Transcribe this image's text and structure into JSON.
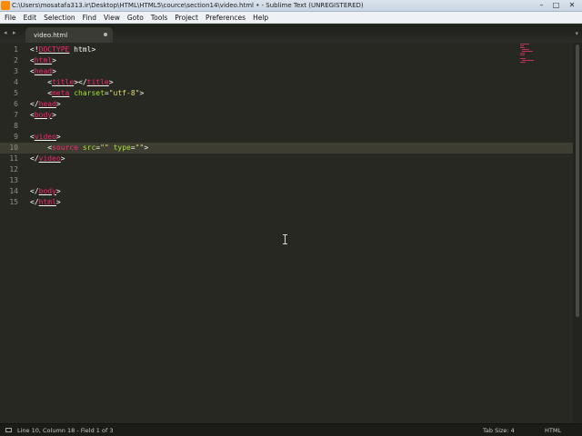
{
  "window": {
    "title": "C:\\Users\\mosatafa313.ir\\Desktop\\HTML\\HTML5\\cource\\section14\\video.html • - Sublime Text (UNREGISTERED)",
    "minimize": "–",
    "maximize": "□",
    "close": "✕"
  },
  "menu": [
    "File",
    "Edit",
    "Selection",
    "Find",
    "View",
    "Goto",
    "Tools",
    "Project",
    "Preferences",
    "Help"
  ],
  "tabs": {
    "nav_left": "◂",
    "nav_right": "▸",
    "active_label": "video.html",
    "dropdown": "▾"
  },
  "editor": {
    "active_line": 10,
    "lines": [
      {
        "n": "1",
        "tokens": [
          [
            "br",
            "<!"
          ],
          [
            "tag",
            "DOCTYPE"
          ],
          [
            "txt",
            " html"
          ],
          [
            "br",
            ">"
          ]
        ]
      },
      {
        "n": "2",
        "tokens": [
          [
            "br",
            "<"
          ],
          [
            "tag",
            "html"
          ],
          [
            "br",
            ">"
          ]
        ]
      },
      {
        "n": "3",
        "tokens": [
          [
            "br",
            "<"
          ],
          [
            "tag",
            "head"
          ],
          [
            "br",
            ">"
          ]
        ]
      },
      {
        "n": "4",
        "tokens": [
          [
            "txt",
            "    "
          ],
          [
            "br",
            "<"
          ],
          [
            "tag",
            "title"
          ],
          [
            "br",
            "></"
          ],
          [
            "tag",
            "title"
          ],
          [
            "br",
            ">"
          ]
        ]
      },
      {
        "n": "5",
        "tokens": [
          [
            "txt",
            "    "
          ],
          [
            "br",
            "<"
          ],
          [
            "tag",
            "meta"
          ],
          [
            "txt",
            " "
          ],
          [
            "attr",
            "charset"
          ],
          [
            "br",
            "="
          ],
          [
            "str",
            "\"utf-8\""
          ],
          [
            "br",
            ">"
          ]
        ]
      },
      {
        "n": "6",
        "tokens": [
          [
            "br",
            "</"
          ],
          [
            "tag",
            "head"
          ],
          [
            "br",
            ">"
          ]
        ]
      },
      {
        "n": "7",
        "tokens": [
          [
            "br",
            "<"
          ],
          [
            "tag",
            "body"
          ],
          [
            "br",
            ">"
          ]
        ]
      },
      {
        "n": "8",
        "tokens": []
      },
      {
        "n": "9",
        "tokens": [
          [
            "br",
            "<"
          ],
          [
            "tag",
            "video"
          ],
          [
            "br",
            ">"
          ]
        ]
      },
      {
        "n": "10",
        "tokens": [
          [
            "txt",
            "    "
          ],
          [
            "br",
            "<"
          ],
          [
            "tagp",
            "source"
          ],
          [
            "txt",
            " "
          ],
          [
            "attr",
            "src"
          ],
          [
            "br",
            "="
          ],
          [
            "str",
            "\"\""
          ],
          [
            "txt",
            " "
          ],
          [
            "attr",
            "type"
          ],
          [
            "br",
            "="
          ],
          [
            "str",
            "\"\""
          ],
          [
            "br",
            ">"
          ]
        ]
      },
      {
        "n": "11",
        "tokens": [
          [
            "br",
            "</"
          ],
          [
            "tag",
            "video"
          ],
          [
            "br",
            ">"
          ]
        ]
      },
      {
        "n": "12",
        "tokens": []
      },
      {
        "n": "13",
        "tokens": []
      },
      {
        "n": "14",
        "tokens": [
          [
            "br",
            "</"
          ],
          [
            "tag",
            "body"
          ],
          [
            "br",
            ">"
          ]
        ]
      },
      {
        "n": "15",
        "tokens": [
          [
            "br",
            "</"
          ],
          [
            "tag",
            "html"
          ],
          [
            "br",
            ">"
          ]
        ]
      }
    ]
  },
  "status": {
    "position": "Line 10, Column 18 - Field 1 of 3",
    "tab_size": "Tab Size: 4",
    "syntax": "HTML"
  },
  "colors": {
    "background": "#272822",
    "tag": "#f92672",
    "attribute": "#a6e22e",
    "string": "#e6db74",
    "text": "#f8f8f2",
    "line_number": "#8f908a"
  }
}
